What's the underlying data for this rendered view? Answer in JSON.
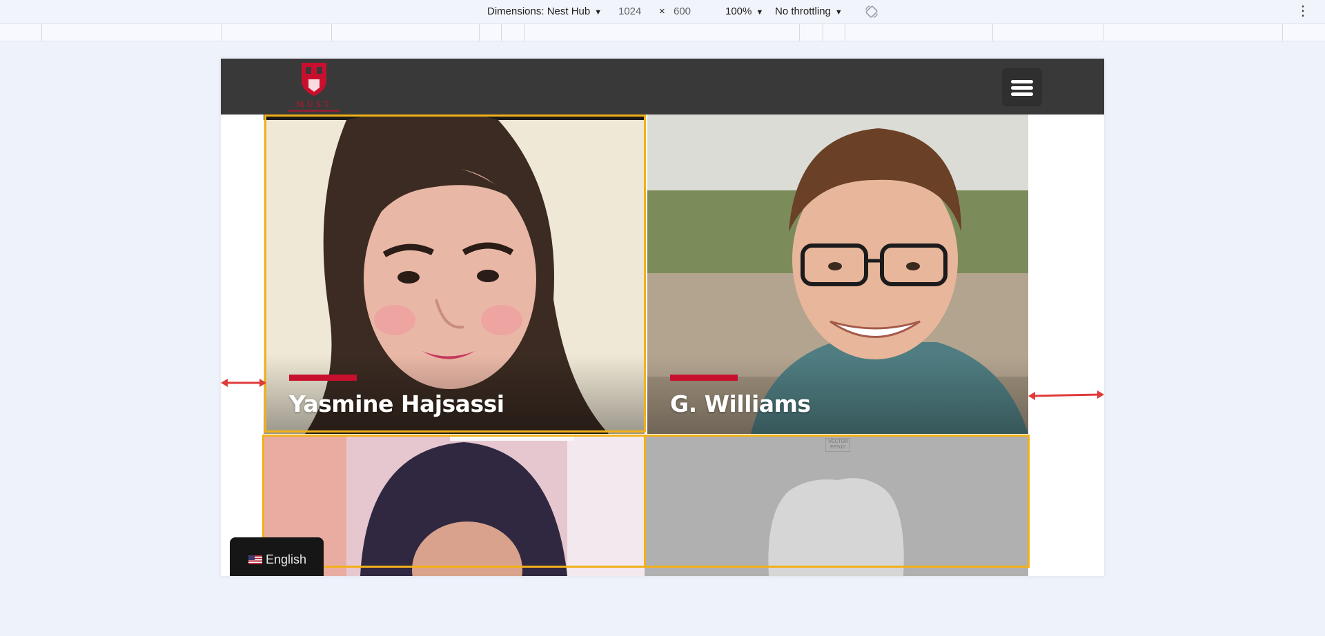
{
  "devtools": {
    "device_label": "Dimensions: Nest Hub",
    "width": "1024",
    "times": "×",
    "height": "600",
    "zoom": "100%",
    "throttling": "No throttling",
    "more_menu": "⋮"
  },
  "site": {
    "logo_text": "MUST",
    "colors": {
      "brand_red": "#c8102e",
      "header_bg": "#393939",
      "outline": "#f2b019"
    },
    "menu_icon": "hamburger-icon"
  },
  "team": [
    {
      "name": "Yasmine Hajsassi"
    },
    {
      "name": "G. Williams"
    },
    {
      "name": ""
    },
    {
      "name": "",
      "placeholder_tag": "VECTOR EPS10"
    }
  ],
  "language": {
    "label": "English",
    "flag": "us-flag-icon"
  }
}
